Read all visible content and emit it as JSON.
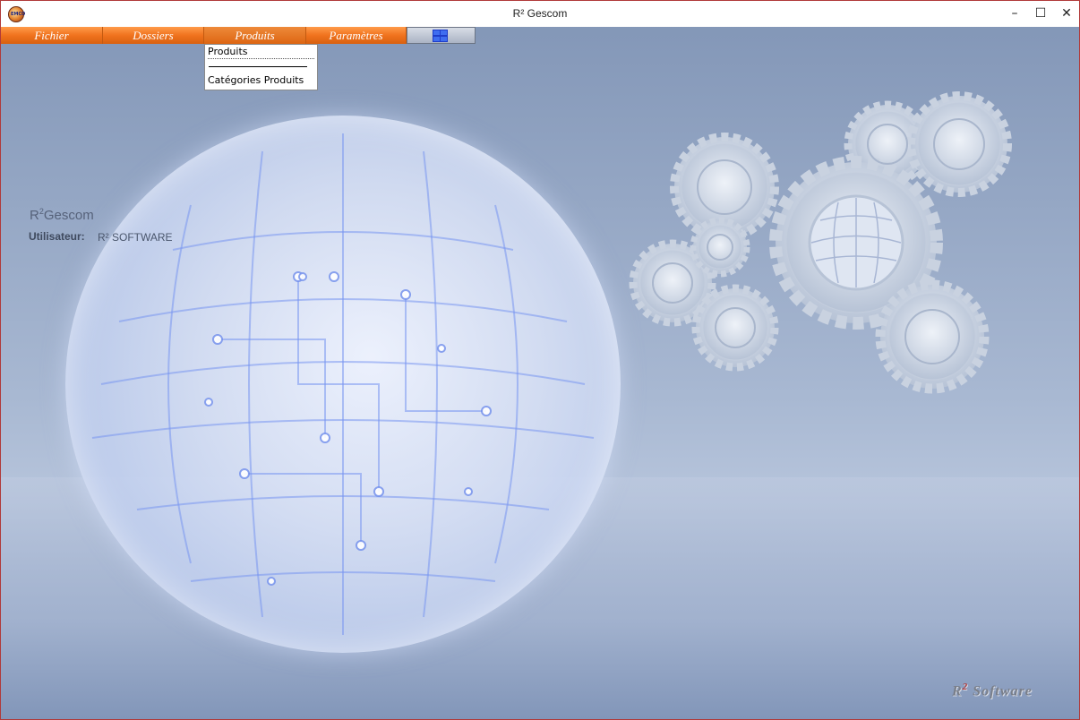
{
  "window": {
    "title": "R² Gescom",
    "icon_name": "app-globe-icon",
    "controls": {
      "minimize": "–",
      "maximize": "☐",
      "close": "✕"
    }
  },
  "menubar": {
    "items": [
      {
        "label": "Fichier"
      },
      {
        "label": "Dossiers"
      },
      {
        "label": "Produits",
        "active": true
      },
      {
        "label": "Paramètres"
      }
    ],
    "extra_icon": "windows-grid-icon"
  },
  "dropdown": {
    "items": [
      "Produits",
      "Catégories Produits"
    ]
  },
  "info": {
    "app_name_base": "R",
    "app_name_sup": "2",
    "app_name_rest": "Gescom",
    "user_label": "Utilisateur:",
    "user_value": "R² SOFTWARE"
  },
  "brand": {
    "base": "R",
    "sup": "2",
    "rest": " Software"
  },
  "colors": {
    "menu_orange": "#f0731e",
    "background": "#a8b8d2",
    "window_border": "#b03a3a"
  }
}
